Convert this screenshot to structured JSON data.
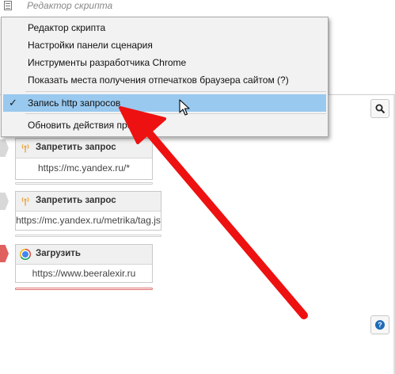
{
  "window": {
    "title": "Редактор скрипта"
  },
  "context_menu": {
    "items": [
      {
        "label": "Редактор скрипта",
        "checked": false,
        "selected": false
      },
      {
        "label": "Настройки панели сценария",
        "checked": false,
        "selected": false
      },
      {
        "label": "Инструменты разработчика Chrome",
        "checked": false,
        "selected": false
      },
      {
        "label": "Показать места получения отпечатков браузера сайтом (?)",
        "checked": false,
        "selected": false
      },
      {
        "label": "Запись http запросов",
        "checked": true,
        "selected": true
      },
      {
        "label": "Обновить действия проекта",
        "checked": false,
        "selected": false
      }
    ],
    "check_mark": "✓"
  },
  "blocks": [
    {
      "title": "Запретить запрос",
      "value": "https://mc.yandex.ru/*",
      "icon": "wifi-icon"
    },
    {
      "title": "Запретить запрос",
      "value": "https://mc.yandex.ru/metrika/tag.js",
      "icon": "wifi-icon"
    },
    {
      "title": "Загрузить",
      "value": "https://www.beeralexir.ru",
      "icon": "chrome-icon"
    }
  ],
  "toolbar": {
    "search_icon": "search-icon",
    "help_icon": "help-icon",
    "help_glyph": "?"
  },
  "colors": {
    "menu_highlight": "#99c9ef",
    "annotation_arrow": "#ee1111",
    "block_connector_active": "#e06060"
  }
}
